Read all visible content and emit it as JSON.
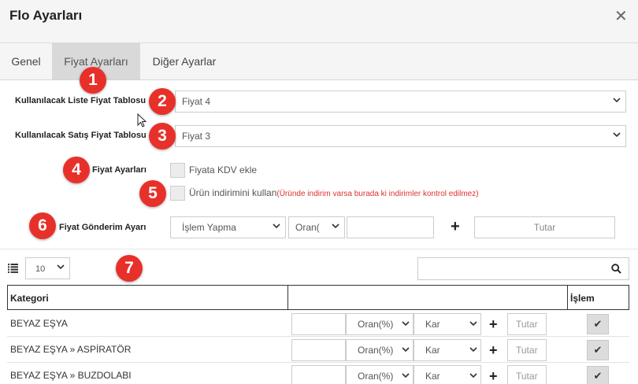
{
  "window": {
    "title": "Flo Ayarları"
  },
  "tabs": [
    {
      "label": "Genel"
    },
    {
      "label": "Fiyat Ayarları"
    },
    {
      "label": "Diğer Ayarlar"
    }
  ],
  "form": {
    "list_price_label": "Kullanılacak Liste Fiyat Tablosu",
    "list_price_value": "Fiyat 4",
    "sales_price_label": "Kullanılacak Satış Fiyat Tablosu",
    "sales_price_value": "Fiyat 3",
    "price_settings_label": "Fiyat Ayarları",
    "kdv_checkbox_label": "Fiyata KDV ekle",
    "discount_checkbox_label": "Ürün indirimini kullan",
    "discount_warning": "(Üründe indirim varsa burada ki indirimler kontrol edilmez)",
    "send_label": "Fiyat Gönderim Ayarı",
    "send_mode_value": "İşlem Yapma",
    "send_ratio_value": "Oran(",
    "tutar_placeholder": "Tutar"
  },
  "badges": [
    "1",
    "2",
    "3",
    "4",
    "5",
    "6",
    "7"
  ],
  "table": {
    "page_size": "10",
    "columns": [
      "Kategori",
      "",
      "İşlem"
    ],
    "rows": [
      {
        "category": "BEYAZ EŞYA",
        "ratio": "Oran(%)",
        "type": "Kar",
        "tutar": "Tutar"
      },
      {
        "category": "BEYAZ EŞYA » ASPİRATÖR",
        "ratio": "Oran(%)",
        "type": "Kar",
        "tutar": "Tutar"
      },
      {
        "category": "BEYAZ EŞYA » BUZDOLABI",
        "ratio": "Oran(%)",
        "type": "Kar",
        "tutar": "Tutar"
      }
    ],
    "action_icon": "check-icon"
  },
  "colors": {
    "badge": "#e8302a",
    "warning": "#e03030",
    "active_tab": "#d9d9d9"
  }
}
